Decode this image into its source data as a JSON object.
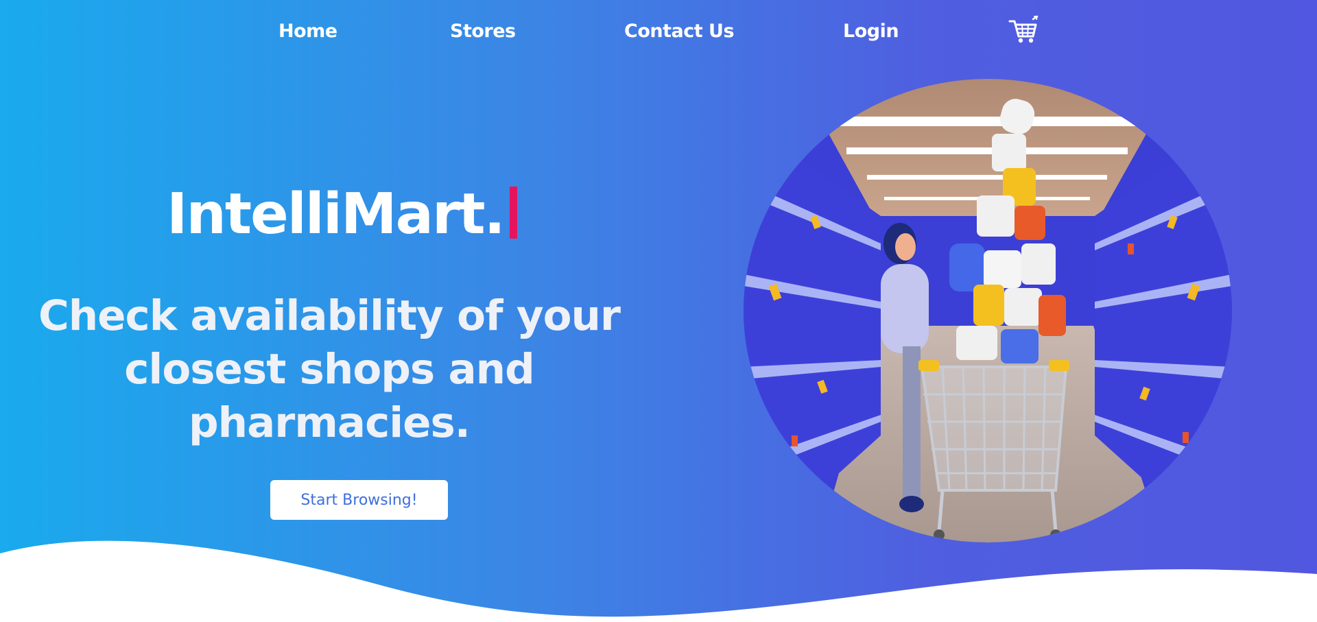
{
  "nav": {
    "items": [
      {
        "label": "Home"
      },
      {
        "label": "Stores"
      },
      {
        "label": "Contact Us"
      },
      {
        "label": "Login"
      }
    ],
    "cart_icon": "shopping-cart-icon"
  },
  "hero": {
    "brand": "IntelliMart.",
    "tagline": "Check availability of your closest shops and pharmacies.",
    "cta_label": "Start Browsing!",
    "illustration": "woman-with-overloaded-shopping-cart-in-empty-store-aisle"
  },
  "colors": {
    "gradient_start": "#1aaaed",
    "gradient_end": "#5157e0",
    "caret_accent": "#e6145f",
    "button_text": "#3e6fdd"
  }
}
